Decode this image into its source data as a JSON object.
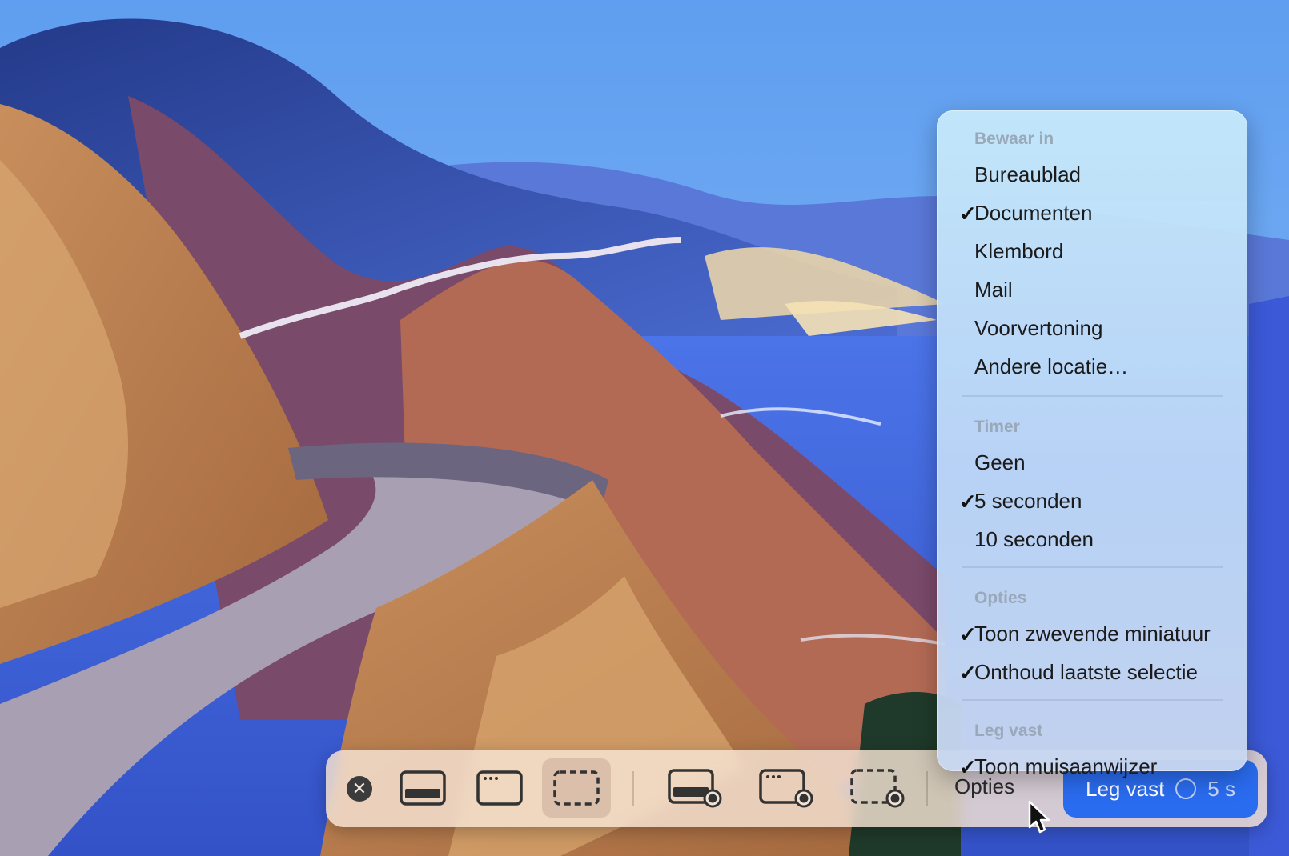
{
  "menu": {
    "sections": [
      {
        "header": "Bewaar in",
        "items": [
          {
            "label": "Bureaublad",
            "checked": false
          },
          {
            "label": "Documenten",
            "checked": true
          },
          {
            "label": "Klembord",
            "checked": false
          },
          {
            "label": "Mail",
            "checked": false
          },
          {
            "label": "Voorvertoning",
            "checked": false
          },
          {
            "label": "Andere locatie…",
            "checked": false
          }
        ]
      },
      {
        "header": "Timer",
        "items": [
          {
            "label": "Geen",
            "checked": false
          },
          {
            "label": "5 seconden",
            "checked": true
          },
          {
            "label": "10 seconden",
            "checked": false
          }
        ]
      },
      {
        "header": "Opties",
        "items": [
          {
            "label": "Toon zwevende miniatuur",
            "checked": true
          },
          {
            "label": "Onthoud laatste selectie",
            "checked": true
          }
        ]
      },
      {
        "header": "Leg vast",
        "items": [
          {
            "label": "Toon muisaanwijzer",
            "checked": true
          }
        ]
      }
    ],
    "check_glyph": "✓"
  },
  "toolbar": {
    "close_glyph": "✕",
    "options_label": "Opties",
    "capture_label": "Leg vast",
    "capture_timer": "5 s",
    "accent_color": "#2a6cf0"
  }
}
